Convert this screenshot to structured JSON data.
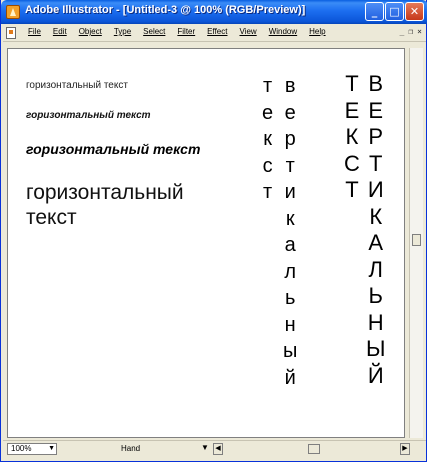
{
  "window": {
    "title": "Adobe Illustrator - [Untitled-3 @ 100% (RGB/Preview)]",
    "buttons": {
      "minimize": "_",
      "maximize": "□",
      "close": "✕"
    }
  },
  "menu": {
    "items": [
      "File",
      "Edit",
      "Object",
      "Type",
      "Select",
      "Filter",
      "Effect",
      "View",
      "Window",
      "Help"
    ],
    "mdi": {
      "minimize": "_",
      "restore": "❐",
      "close": "×"
    }
  },
  "artboard": {
    "horizontal": [
      "горизонтальный текст",
      "горизонтальный текст",
      "горизонтальный текст",
      "горизонтальный",
      "текст"
    ],
    "vertical_lower": {
      "col1": [
        "т",
        "е",
        "к",
        "с",
        "т"
      ],
      "col2": [
        "в",
        "е",
        "р",
        "т",
        "и",
        "к",
        "а",
        "л",
        "ь",
        "н",
        "ы",
        "й"
      ]
    },
    "vertical_upper": {
      "col1": [
        "Т",
        "Е",
        "К",
        "С",
        "Т"
      ],
      "col2": [
        "В",
        "Е",
        "Р",
        "Т",
        "И",
        "К",
        "А",
        "Л",
        "Ь",
        "Н",
        "Ы",
        "Й"
      ]
    }
  },
  "statusbar": {
    "zoom": "100%",
    "tool": "Hand"
  }
}
